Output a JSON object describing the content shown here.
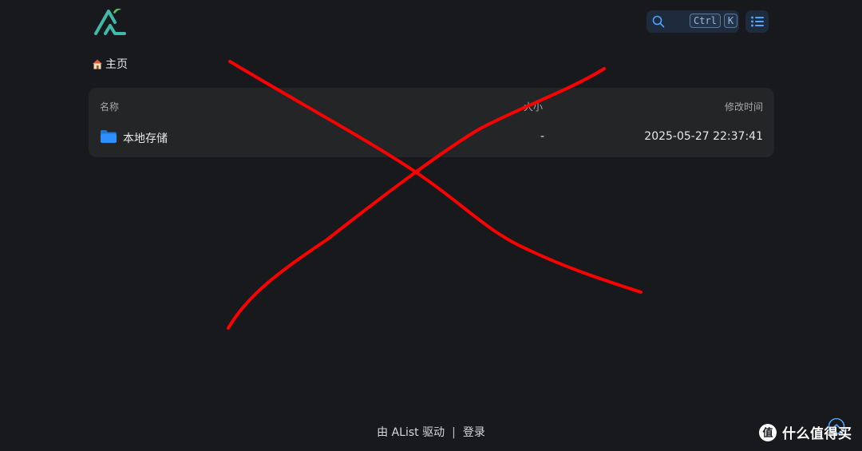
{
  "breadcrumb": {
    "home_label": "主页"
  },
  "search": {
    "shortcut_keys": [
      "Ctrl",
      "K"
    ]
  },
  "table": {
    "headers": {
      "name": "名称",
      "size": "大小",
      "modified": "修改时间"
    },
    "rows": [
      {
        "name": "本地存储",
        "size": "-",
        "modified": "2025-05-27 22:37:41",
        "icon": "folder-icon"
      }
    ]
  },
  "footer": {
    "powered_by": "由 AList 驱动",
    "separator": "|",
    "login": "登录"
  },
  "watermark": {
    "text": "什么值得买",
    "badge": "值"
  },
  "colors": {
    "background": "#18191c",
    "panel": "#232527",
    "accent": "#4da3ff",
    "logo": "#3fb9a8",
    "folder": "#2f8fff",
    "annotation": "#ff0000"
  }
}
